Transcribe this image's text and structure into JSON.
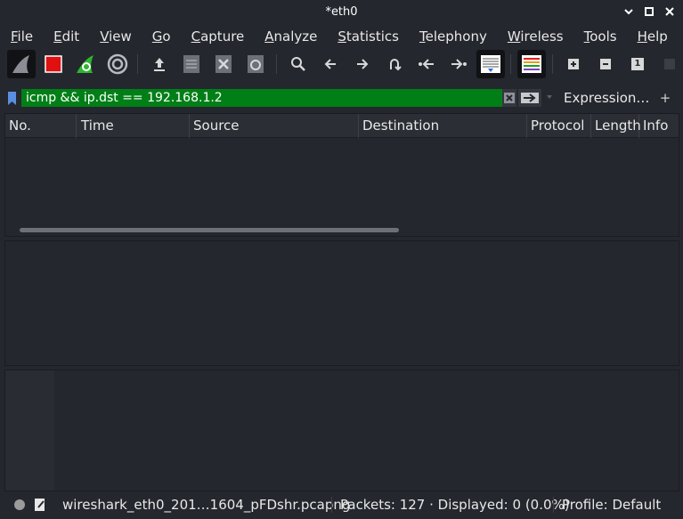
{
  "window": {
    "title": "*eth0",
    "minimize_icon": "chevron-down-icon",
    "maximize_icon": "square-icon",
    "close_icon": "close-icon"
  },
  "menu": {
    "items": [
      {
        "label": "File",
        "mnemonic": "F",
        "rest": "ile"
      },
      {
        "label": "Edit",
        "mnemonic": "E",
        "rest": "dit"
      },
      {
        "label": "View",
        "mnemonic": "V",
        "rest": "iew"
      },
      {
        "label": "Go",
        "mnemonic": "G",
        "rest": "o"
      },
      {
        "label": "Capture",
        "mnemonic": "C",
        "rest": "apture"
      },
      {
        "label": "Analyze",
        "mnemonic": "A",
        "rest": "nalyze"
      },
      {
        "label": "Statistics",
        "mnemonic": "S",
        "rest": "tatistics"
      },
      {
        "label": "Telephony",
        "mnemonic": "T",
        "rest": "elephony"
      },
      {
        "label": "Wireless",
        "mnemonic": "W",
        "rest": "ireless"
      },
      {
        "label": "Tools",
        "mnemonic": "T",
        "rest": "ools"
      },
      {
        "label": "Help",
        "mnemonic": "H",
        "rest": "elp"
      }
    ]
  },
  "toolbar": {
    "buttons": [
      "shark-fin-start-icon",
      "stop-capture-icon",
      "restart-capture-icon",
      "capture-options-gear-icon",
      "open-file-icon",
      "save-file-icon",
      "close-file-icon",
      "reload-file-icon",
      "find-packet-icon",
      "go-back-icon",
      "go-forward-icon",
      "go-to-packet-icon",
      "go-first-packet-icon",
      "go-last-packet-icon",
      "autoscroll-icon",
      "colorize-icon",
      "zoom-in-icon",
      "zoom-out-icon",
      "normal-size-icon",
      "resize-columns-icon"
    ],
    "normal_size_label": "1"
  },
  "filter": {
    "value": "icmp && ip.dst == 192.168.1.2",
    "expression_label": "Expression…",
    "add_label": "+",
    "accent_color": "#007f16"
  },
  "packet_list": {
    "columns": [
      "No.",
      "Time",
      "Source",
      "Destination",
      "Protocol",
      "Length",
      "Info"
    ],
    "rows": []
  },
  "status": {
    "file": "wireshark_eth0_201…1604_pFDshr.pcapng",
    "packets": "Packets: 127 · Displayed: 0 (0.0%)",
    "profile": "Profile: Default"
  }
}
